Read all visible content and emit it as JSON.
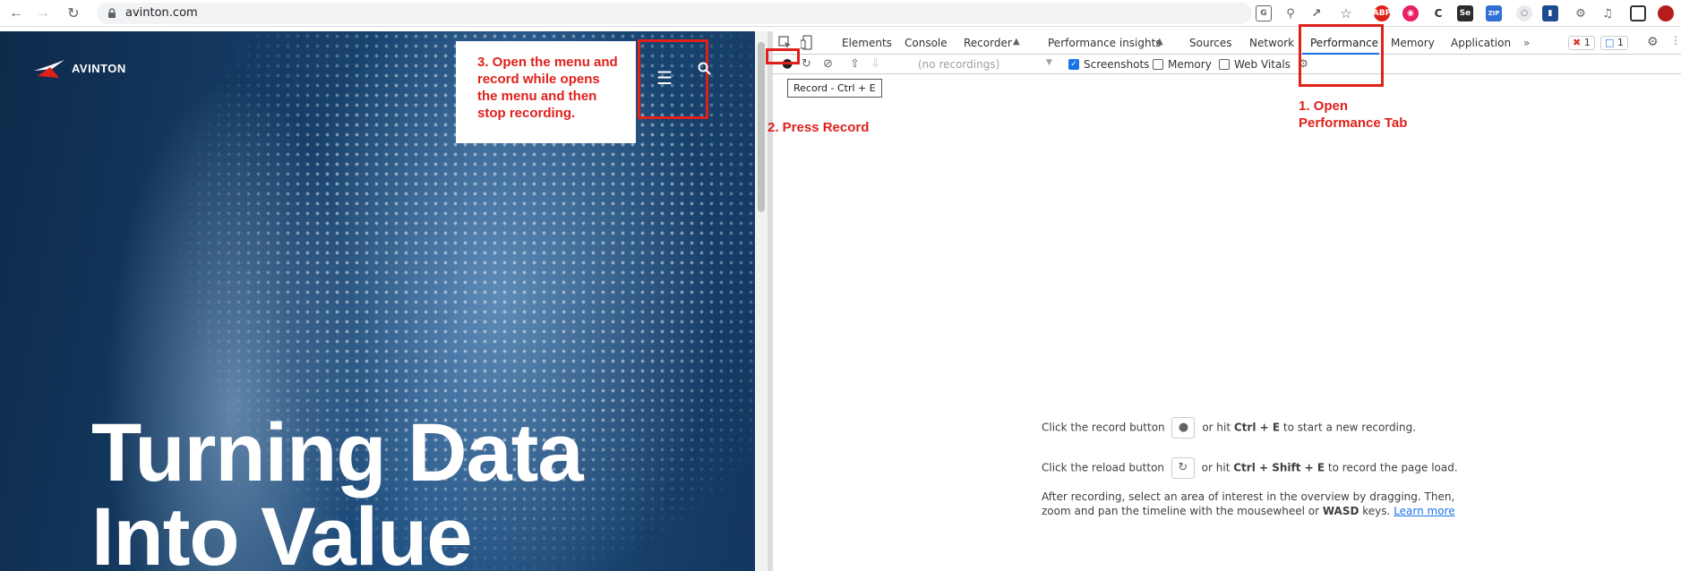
{
  "browser": {
    "url": "avinton.com"
  },
  "page": {
    "logo_text": "AVINTON",
    "hero_line1": "Turning Data",
    "hero_line2": "Into Value",
    "callout_text": "3. Open the menu and record while opens the menu and then stop recording."
  },
  "devtools": {
    "tabs": [
      "Elements",
      "Console",
      "Recorder",
      "Performance insights",
      "Sources",
      "Network",
      "Performance",
      "Memory",
      "Application"
    ],
    "active_tab": "Performance",
    "errors_count": "1",
    "messages_count": "1",
    "recordings_placeholder": "(no recordings)",
    "checkbox_screenshots": "Screenshots",
    "checkbox_memory": "Memory",
    "checkbox_web_vitals": "Web Vitals",
    "tooltip": "Record - Ctrl + E",
    "instructions": {
      "line1_prefix": "Click the record button",
      "line1_suffix_a": "or hit",
      "line1_keys": "Ctrl + E",
      "line1_suffix_b": "to start a new recording.",
      "line2_prefix": "Click the reload button",
      "line2_suffix_a": "or hit",
      "line2_keys": "Ctrl + Shift + E",
      "line2_suffix_b": "to record the page load.",
      "line3a": "After recording, select an area of interest in the overview by dragging. Then,",
      "line3b_prefix": "zoom and pan the timeline with the mousewheel or",
      "line3b_keys": "WASD",
      "line3b_suffix": "keys.",
      "learn_more": "Learn more"
    }
  },
  "annotations": {
    "step1_line1": "1. Open",
    "step1_line2": "Performance Tab",
    "step2": "2. Press Record",
    "color": "#e0201b"
  }
}
